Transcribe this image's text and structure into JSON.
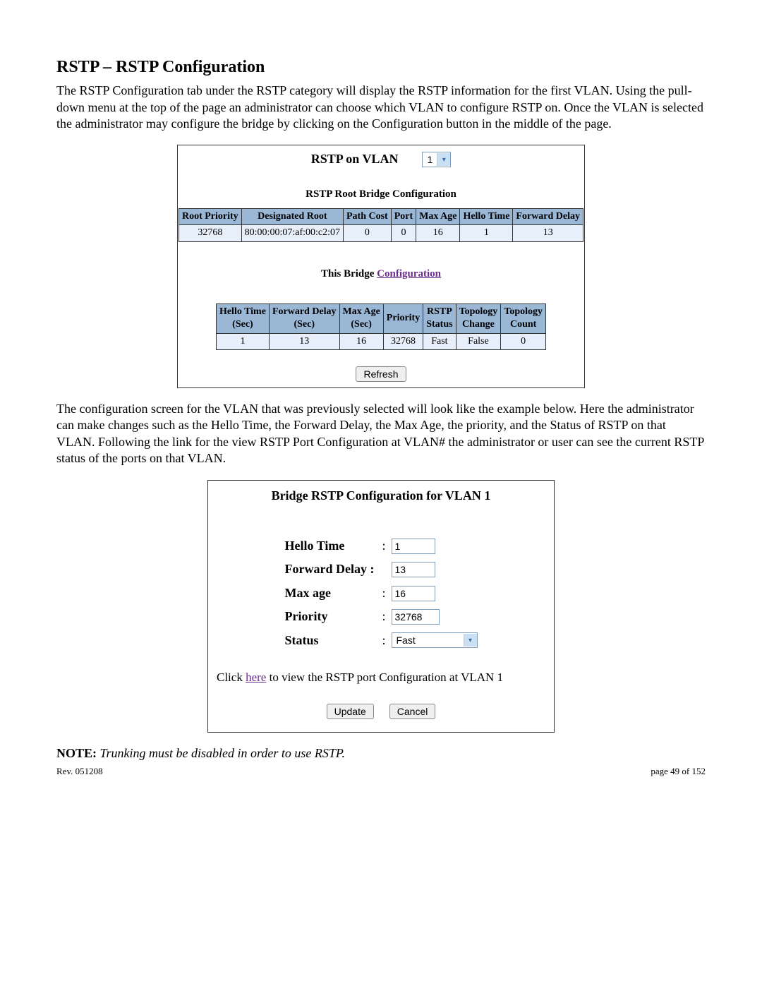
{
  "heading": "RSTP – RSTP Configuration",
  "intro_para": "The RSTP Configuration tab under the RSTP category will display the RSTP information for the first VLAN.  Using the pull-down menu at the top of the page an administrator can choose which VLAN to configure RSTP on.  Once the VLAN is selected the administrator may configure the bridge by clicking on the Configuration button in the middle of the page.",
  "panel1": {
    "title": "RSTP on VLAN",
    "vlan_value": "1",
    "root_heading": "RSTP Root Bridge Configuration",
    "root_headers": [
      "Root Priority",
      "Designated Root",
      "Path Cost",
      "Port",
      "Max Age",
      "Hello Time",
      "Forward Delay"
    ],
    "root_row": [
      "32768",
      "80:00:00:07:af:00:c2:07",
      "0",
      "0",
      "16",
      "1",
      "13"
    ],
    "this_bridge_label": "This Bridge ",
    "config_link": "Configuration",
    "bridge_headers_line1": [
      "Hello Time",
      "Forward Delay",
      "Max Age",
      "Priority",
      "RSTP",
      "Topology",
      "Topology"
    ],
    "bridge_headers_line2": [
      "(Sec)",
      "(Sec)",
      "(Sec)",
      "",
      "Status",
      "Change",
      "Count"
    ],
    "bridge_row": [
      "1",
      "13",
      "16",
      "32768",
      "Fast",
      "False",
      "0"
    ],
    "refresh_label": "Refresh"
  },
  "mid_para": "The configuration screen for the VLAN that was previously selected will look like the example below.  Here the administrator can make changes such as the Hello Time, the Forward Delay, the Max Age, the priority, and the Status of RSTP on that VLAN.  Following the link for the view RSTP Port Configuration at VLAN# the administrator or user can see the current RSTP status of the ports on that VLAN.",
  "panel2": {
    "title": "Bridge RSTP Configuration for VLAN 1",
    "fields": {
      "hello_time_label": "Hello Time",
      "hello_time_value": "1",
      "forward_delay_label": "Forward Delay :",
      "forward_delay_value": "13",
      "max_age_label": "Max age",
      "max_age_value": "16",
      "priority_label": "Priority",
      "priority_value": "32768",
      "status_label": "Status",
      "status_value": "Fast"
    },
    "link_prefix": "Click  ",
    "link_text": "here",
    "link_suffix": "  to view the RSTP port Configuration at VLAN 1",
    "update_label": "Update",
    "cancel_label": "Cancel"
  },
  "note_bold": "NOTE:",
  "note_italic": " Trunking must be disabled in order to use RSTP.",
  "footer_left": "Rev.  051208",
  "footer_right": "page 49 of 152"
}
